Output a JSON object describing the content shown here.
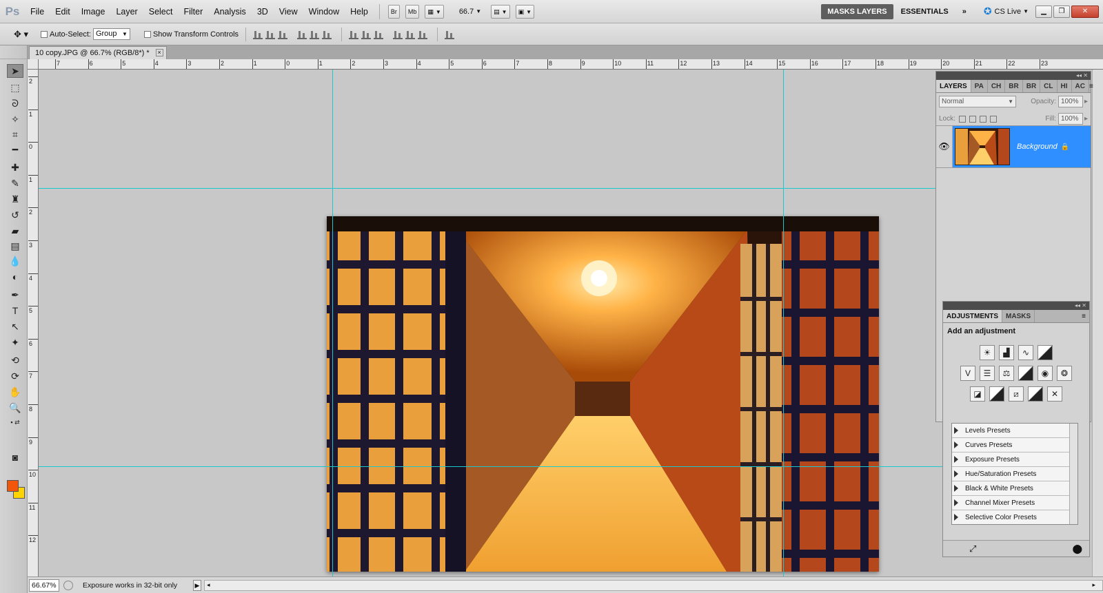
{
  "app": {
    "logo": "Ps"
  },
  "menu": [
    "File",
    "Edit",
    "Image",
    "Layer",
    "Select",
    "Filter",
    "Analysis",
    "3D",
    "View",
    "Window",
    "Help"
  ],
  "menubar": {
    "br_label": "Br",
    "mb_label": "Mb",
    "zoom": "66.7",
    "workspaces": [
      "MASKS LAYERS",
      "ESSENTIALS"
    ],
    "more": "»",
    "cslive": "CS Live"
  },
  "options": {
    "auto_select_label": "Auto-Select:",
    "auto_select_value": "Group",
    "transform_label": "Show Transform Controls"
  },
  "document": {
    "tab_title": "10 copy.JPG @ 66.7% (RGB/8*) *",
    "close": "×"
  },
  "rulers": {
    "h_ticks": [
      "7",
      "6",
      "5",
      "4",
      "3",
      "2",
      "1",
      "0",
      "1",
      "2",
      "3",
      "4",
      "5",
      "6",
      "7",
      "8",
      "9",
      "10",
      "11",
      "12",
      "13",
      "14",
      "15",
      "16",
      "17",
      "18",
      "19",
      "20",
      "21",
      "22",
      "23"
    ],
    "v_ticks": [
      "2",
      "1",
      "0",
      "1",
      "2",
      "3",
      "4",
      "5",
      "6",
      "7",
      "8",
      "9",
      "10",
      "11",
      "12"
    ]
  },
  "layers_panel": {
    "tabs": [
      "LAYERS",
      "PA",
      "CH",
      "BR",
      "BR",
      "CL",
      "HI",
      "AC"
    ],
    "blend_mode": "Normal",
    "opacity_label": "Opacity:",
    "opacity_value": "100%",
    "lock_label": "Lock:",
    "fill_label": "Fill:",
    "fill_value": "100%",
    "layer_name": "Background"
  },
  "adjustments_panel": {
    "tabs": [
      "ADJUSTMENTS",
      "MASKS"
    ],
    "header": "Add an adjustment",
    "presets": [
      "Levels Presets",
      "Curves Presets",
      "Exposure Presets",
      "Hue/Saturation Presets",
      "Black & White Presets",
      "Channel Mixer Presets",
      "Selective Color Presets"
    ]
  },
  "status": {
    "zoom": "66.67%",
    "message": "Exposure works in 32-bit only"
  },
  "colors": {
    "foreground": "#f2560a",
    "background": "#ffd400",
    "guide": "#1cc8d0",
    "selection": "#2f8fff"
  }
}
